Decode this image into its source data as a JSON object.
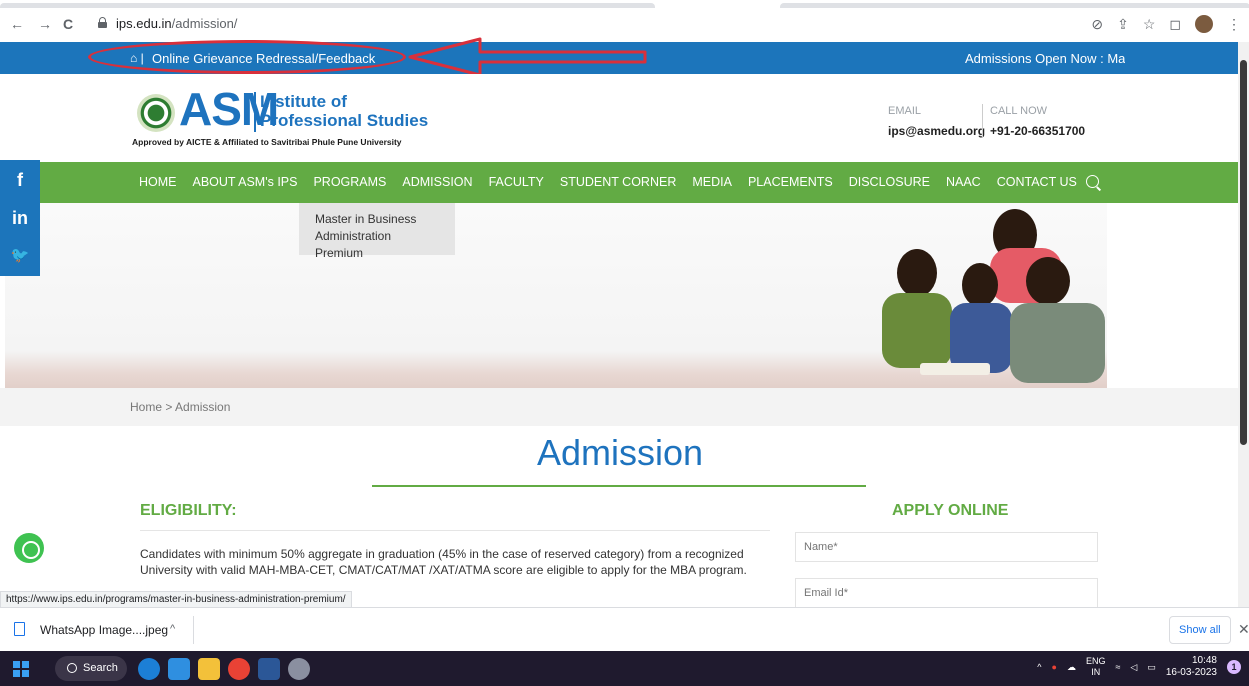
{
  "browser": {
    "back_icon": "←",
    "forward_icon": "→",
    "reload_icon": "C",
    "url_host": "ips.edu.in",
    "url_path": "/admission/",
    "status_url": "https://www.ips.edu.in/programs/master-in-business-administration-premium/"
  },
  "topbar": {
    "home_glyph": "⌂ |",
    "grievance_link": "Online Grievance Redressal/Feedback",
    "marquee": "Admissions Open Now : Mas"
  },
  "header": {
    "logo_text": "ASM",
    "institute_line1": "Institute of",
    "institute_line2": "Professional Studies",
    "tagline": "Approved by AICTE & Affiliated to Savitribai Phule Pune University",
    "email_label": "EMAIL",
    "email": "ips@asmedu.org",
    "call_label": "CALL NOW",
    "phone": "+91-20-66351700"
  },
  "nav": {
    "items": [
      "HOME",
      "ABOUT ASM's IPS",
      "PROGRAMS",
      "ADMISSION",
      "FACULTY",
      "STUDENT CORNER",
      "MEDIA",
      "PLACEMENTS",
      "DISCLOSURE",
      "NAAC",
      "CONTACT US"
    ],
    "dropdown_item": "Master in Business Administration Premium"
  },
  "social": {
    "facebook": "f",
    "linkedin": "in",
    "twitter": "🐦"
  },
  "breadcrumb": "Home  >  Admission",
  "main": {
    "title": "Admission",
    "eligibility_heading": "ELIGIBILITY:",
    "eligibility_text": "Candidates with minimum 50% aggregate in graduation (45% in the case of reserved category) from a recognized University with valid MAH-MBA-CET, CMAT/CAT/MAT /XAT/ATMA score are eligible to apply for the MBA program.",
    "apply_heading": "APPLY ONLINE",
    "name_placeholder": "Name*",
    "email_placeholder": "Email Id*"
  },
  "downloads": {
    "file_name": "WhatsApp Image....jpeg",
    "caret": "^",
    "show_all": "Show all",
    "close": "✕"
  },
  "taskbar": {
    "search_label": "Search",
    "lang_line1": "ENG",
    "lang_line2": "IN",
    "time": "10:48",
    "date": "16-03-2023",
    "notification_count": "1"
  },
  "colors": {
    "topbar_blue": "#1c75bb",
    "nav_green": "#62ab44",
    "brand_blue": "#1e73be",
    "annotation_red": "#d9303b"
  }
}
